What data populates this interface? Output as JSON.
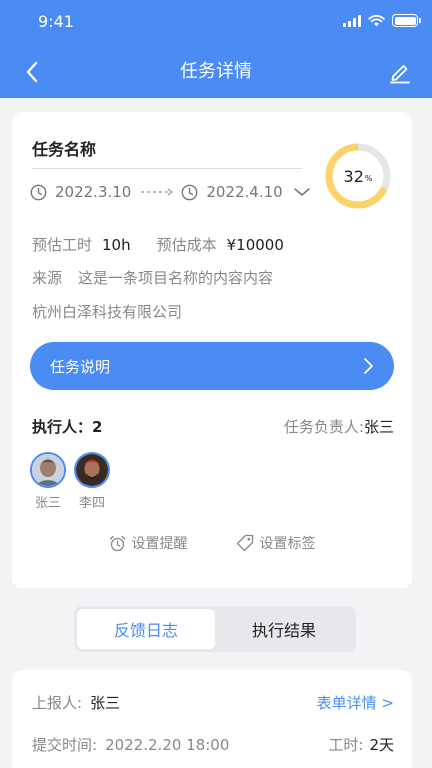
{
  "status": {
    "time": "9:41"
  },
  "nav": {
    "title": "任务详情"
  },
  "task": {
    "name": "任务名称",
    "start_date": "2022.3.10",
    "end_date": "2022.4.10",
    "progress": 32,
    "progress_unit": "%",
    "est_hours_label": "预估工时",
    "est_hours": "10h",
    "est_cost_label": "预估成本",
    "est_cost": "¥10000",
    "source_label": "来源",
    "source_value": "这是一条项目名称的内容内容",
    "company": "杭州白泽科技有限公司"
  },
  "description_button": {
    "label": "任务说明"
  },
  "executors": {
    "label": "执行人：2",
    "owner_label": "任务负责人:",
    "owner_name": "张三",
    "people": [
      {
        "name": "张三"
      },
      {
        "name": "李四"
      }
    ]
  },
  "actions": {
    "reminder": "设置提醒",
    "tag": "设置标签"
  },
  "tabs": [
    {
      "label": "反馈日志",
      "active": true
    },
    {
      "label": "执行结果",
      "active": false
    }
  ],
  "log": {
    "reporter_label": "上报人:",
    "reporter": "张三",
    "form_link": "表单详情 >",
    "submit_label": "提交时间:",
    "submit_time": "2022.2.20  18:00",
    "hours_label": "工时:",
    "hours": "2天"
  },
  "colors": {
    "primary": "#4a8cf3",
    "progress": "#fcd36a",
    "progress_track": "#e6e6e6"
  }
}
